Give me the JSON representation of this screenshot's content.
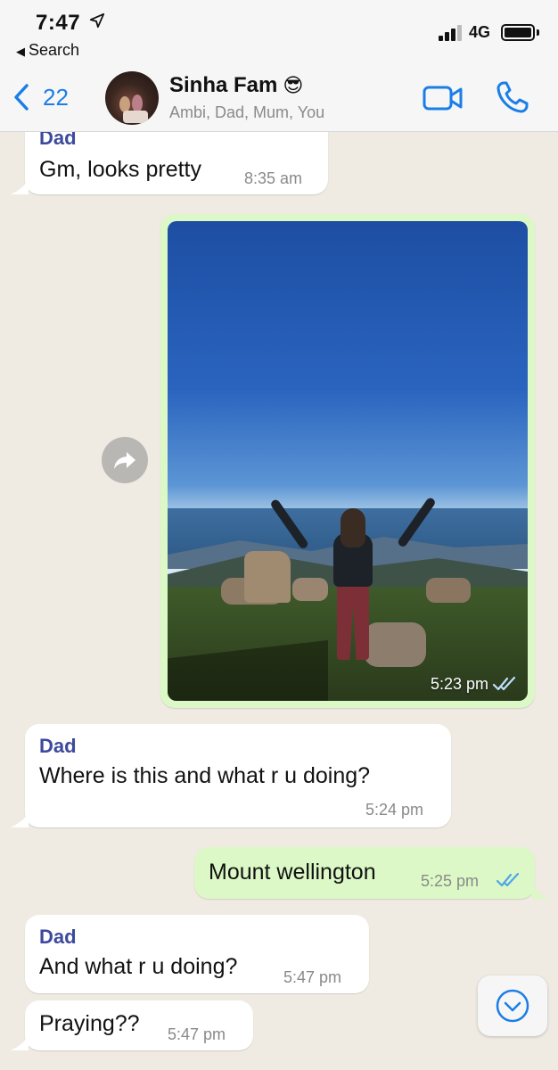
{
  "status_bar": {
    "time": "7:47",
    "back_app": "Search",
    "network": "4G"
  },
  "header": {
    "back_count": "22",
    "chat_name": "Sinha Fam",
    "chat_emoji": "😎",
    "members": "Ambi, Dad, Mum, You",
    "icons": [
      "back-chevron-icon",
      "video-call-icon",
      "voice-call-icon"
    ]
  },
  "messages": [
    {
      "direction": "in",
      "sender": "Dad",
      "text": "Gm, looks pretty",
      "time": "8:35 am"
    },
    {
      "direction": "out",
      "type": "image",
      "time": "5:23 pm",
      "status": "read"
    },
    {
      "direction": "in",
      "sender": "Dad",
      "text": "Where is this and what r u doing?",
      "time": "5:24 pm"
    },
    {
      "direction": "out",
      "text": "Mount wellington",
      "time": "5:25 pm",
      "status": "read"
    },
    {
      "direction": "in",
      "sender": "Dad",
      "text": "And what r u doing?",
      "time": "5:47 pm"
    },
    {
      "direction": "in",
      "text": "Praying??",
      "time": "5:47 pm"
    }
  ],
  "colors": {
    "accent": "#1b7ee6",
    "outgoing_bubble": "#dcf8c6",
    "incoming_bubble": "#ffffff",
    "sender_name": "#3d4a9c",
    "read_ticks": "#4fa6e8",
    "chat_background": "#efeae2"
  }
}
